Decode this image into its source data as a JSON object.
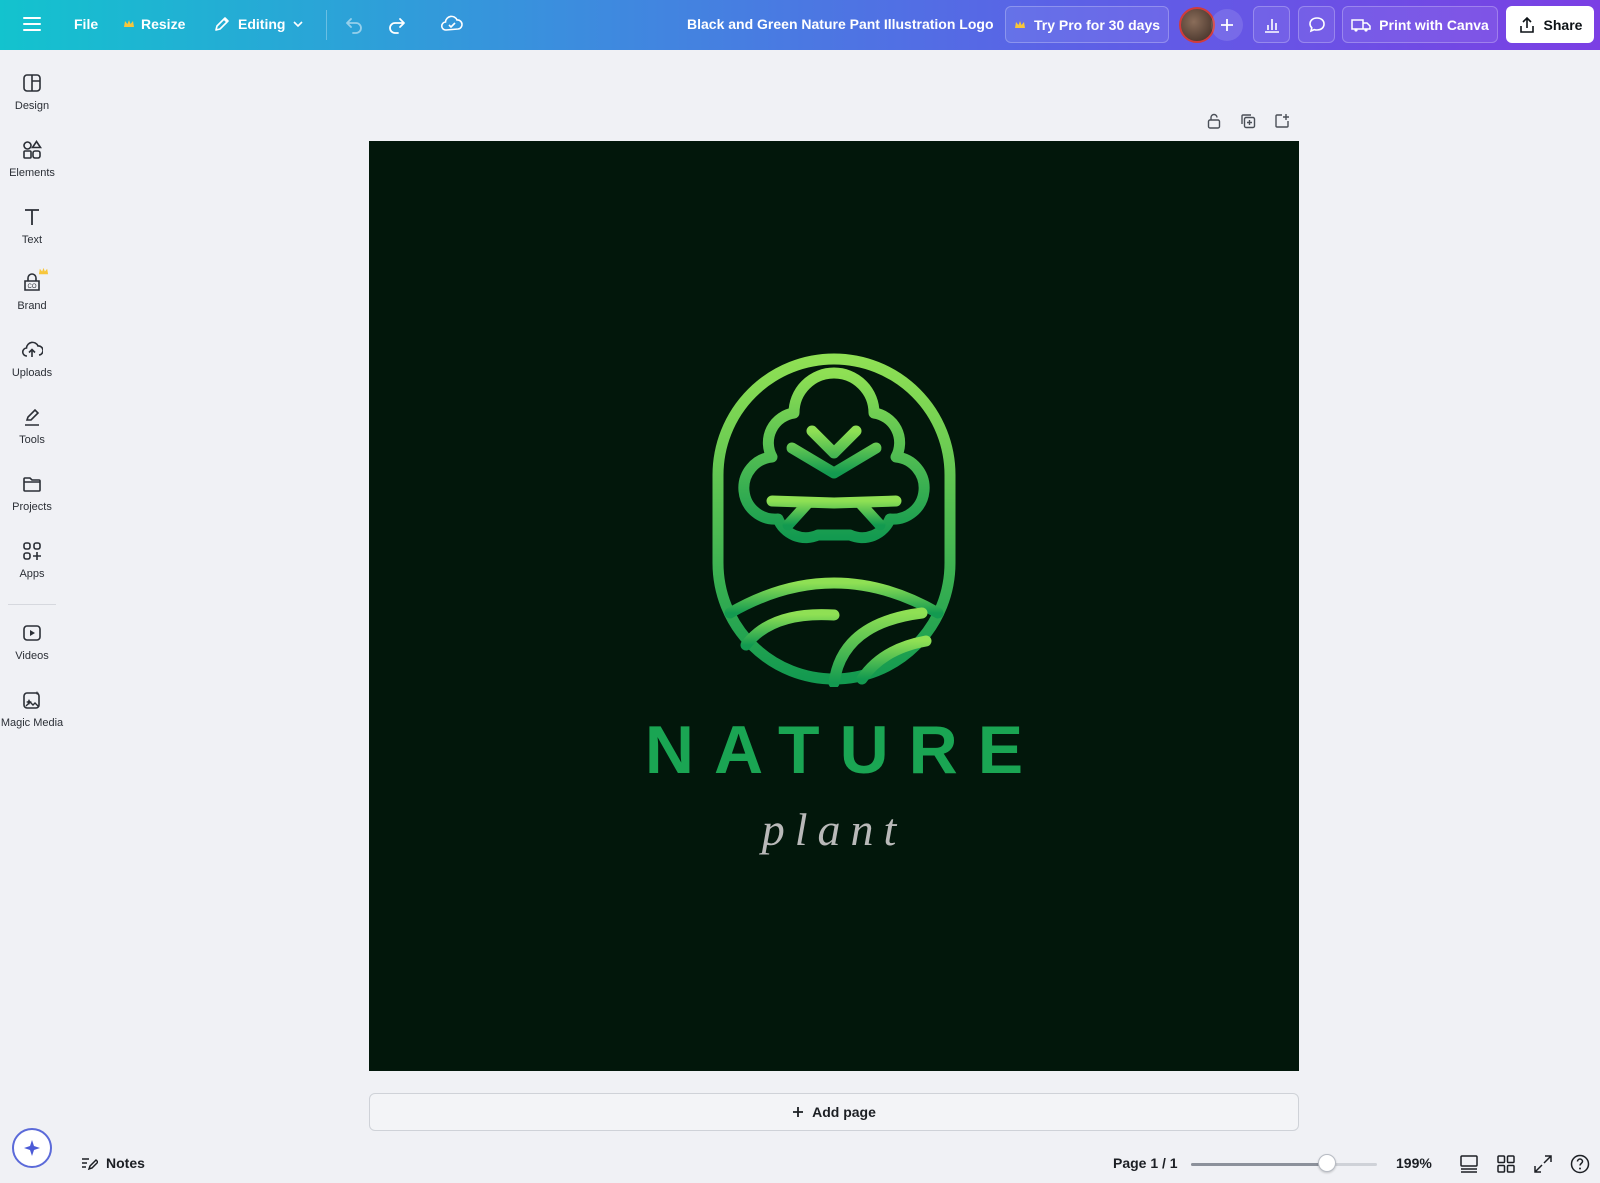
{
  "topbar": {
    "file_label": "File",
    "resize_label": "Resize",
    "editing_label": "Editing",
    "doc_title": "Black and Green Nature Pant Illustration Logo",
    "try_pro_label": "Try Pro for 30 days",
    "print_label": "Print with Canva",
    "share_label": "Share",
    "crown_color": "#f7c63b"
  },
  "sidebar": {
    "items": [
      {
        "label": "Design",
        "icon": "design-icon"
      },
      {
        "label": "Elements",
        "icon": "elements-icon"
      },
      {
        "label": "Text",
        "icon": "text-icon"
      },
      {
        "label": "Brand",
        "icon": "brand-icon"
      },
      {
        "label": "Uploads",
        "icon": "uploads-icon"
      },
      {
        "label": "Tools",
        "icon": "tools-icon"
      },
      {
        "label": "Projects",
        "icon": "projects-icon"
      },
      {
        "label": "Apps",
        "icon": "apps-icon"
      },
      {
        "label": "Videos",
        "icon": "videos-icon"
      },
      {
        "label": "Magic Media",
        "icon": "magic-media-icon"
      }
    ]
  },
  "canvas": {
    "background": "#02170b",
    "logo_title": "NATURE",
    "logo_subtitle": "plant",
    "green_light": "#8fe054",
    "green_dark": "#139a50"
  },
  "add_page_label": "Add page",
  "bottom": {
    "notes_label": "Notes",
    "page_indicator": "Page 1 / 1",
    "zoom_label": "199%",
    "zoom_fraction": 0.73
  }
}
